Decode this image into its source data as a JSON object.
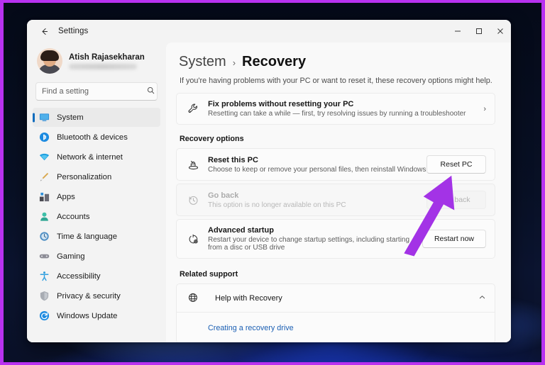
{
  "window": {
    "app_title": "Settings",
    "back_icon": "back-arrow-icon",
    "controls": {
      "minimize": "─",
      "maximize": "☐",
      "close": "✕"
    }
  },
  "sidebar": {
    "profile": {
      "name": "Atish Rajasekharan",
      "email_blurred": ""
    },
    "search": {
      "placeholder": "Find a setting",
      "value": "",
      "icon": "search-icon"
    },
    "items": [
      {
        "label": "System",
        "icon": "monitor-icon",
        "active": true
      },
      {
        "label": "Bluetooth & devices",
        "icon": "bluetooth-icon",
        "active": false
      },
      {
        "label": "Network & internet",
        "icon": "wifi-icon",
        "active": false
      },
      {
        "label": "Personalization",
        "icon": "paintbrush-icon",
        "active": false
      },
      {
        "label": "Apps",
        "icon": "apps-icon",
        "active": false
      },
      {
        "label": "Accounts",
        "icon": "person-icon",
        "active": false
      },
      {
        "label": "Time & language",
        "icon": "clock-globe-icon",
        "active": false
      },
      {
        "label": "Gaming",
        "icon": "gamepad-icon",
        "active": false
      },
      {
        "label": "Accessibility",
        "icon": "accessibility-icon",
        "active": false
      },
      {
        "label": "Privacy & security",
        "icon": "shield-icon",
        "active": false
      },
      {
        "label": "Windows Update",
        "icon": "update-icon",
        "active": false
      }
    ]
  },
  "main": {
    "breadcrumb": {
      "parent": "System",
      "separator": "›",
      "current": "Recovery"
    },
    "description": "If you're having problems with your PC or want to reset it, these recovery options might help.",
    "fix_card": {
      "icon": "wrench-icon",
      "title": "Fix problems without resetting your PC",
      "subtitle": "Resetting can take a while — first, try resolving issues by running a troubleshooter",
      "chevron": "›"
    },
    "recovery_options_heading": "Recovery options",
    "options": [
      {
        "icon": "reset-pc-icon",
        "title": "Reset this PC",
        "subtitle": "Choose to keep or remove your personal files, then reinstall Windows",
        "button": "Reset PC",
        "disabled": false
      },
      {
        "icon": "history-back-icon",
        "title": "Go back",
        "subtitle": "This option is no longer available on this PC",
        "button": "Go back",
        "disabled": true
      },
      {
        "icon": "advanced-startup-icon",
        "title": "Advanced startup",
        "subtitle": "Restart your device to change startup settings, including starting from a disc or USB drive",
        "button": "Restart now",
        "disabled": false
      }
    ],
    "related_support_heading": "Related support",
    "support": {
      "icon": "globe-help-icon",
      "title": "Help with Recovery",
      "chevron": "˄",
      "links": [
        "Creating a recovery drive"
      ]
    }
  },
  "annotation": {
    "arrow_color": "#a333e6",
    "border_color": "#b832f0",
    "points_to": "Reset PC"
  }
}
